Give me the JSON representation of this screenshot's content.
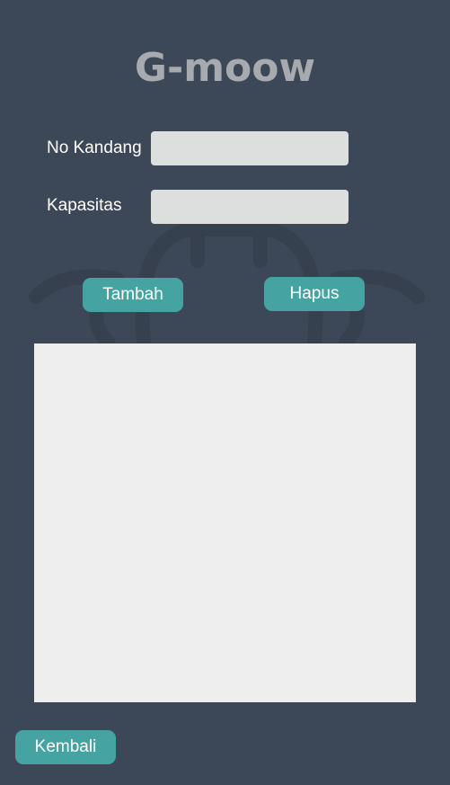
{
  "app": {
    "title": "G-moow"
  },
  "form": {
    "no_kandang_label": "No Kandang",
    "no_kandang_value": "",
    "kapasitas_label": "Kapasitas",
    "kapasitas_value": ""
  },
  "actions": {
    "tambah_label": "Tambah",
    "hapus_label": "Hapus",
    "kembali_label": "Kembali"
  },
  "colors": {
    "background": "#3c4757",
    "accent": "#45a3a2",
    "input_bg": "#dddfdf",
    "list_bg": "#eeeeee",
    "title": "#a7aaae"
  },
  "icons": {
    "background_watermark": "cow-watermark-icon"
  }
}
